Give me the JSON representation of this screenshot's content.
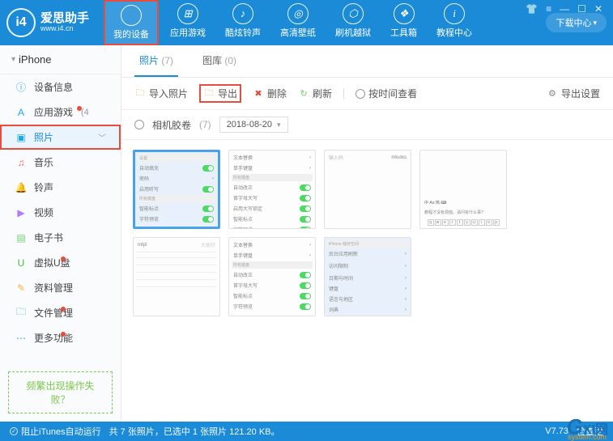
{
  "logo": {
    "title": "爱思助手",
    "url": "www.i4.cn"
  },
  "nav": [
    {
      "label": "我的设备",
      "icon": "",
      "active": true,
      "highlighted": true
    },
    {
      "label": "应用游戏",
      "icon": "⊞"
    },
    {
      "label": "酷炫铃声",
      "icon": "♪"
    },
    {
      "label": "高清壁纸",
      "icon": "◎"
    },
    {
      "label": "刷机越狱",
      "icon": "⬡"
    },
    {
      "label": "工具箱",
      "icon": "❖"
    },
    {
      "label": "教程中心",
      "icon": "i"
    }
  ],
  "download_btn": "下载中心",
  "device_name": "iPhone",
  "sidebar": [
    {
      "label": "设备信息",
      "color": "#1fa8e8",
      "glyph": "ⓘ"
    },
    {
      "label": "应用游戏",
      "color": "#1fa8e8",
      "glyph": "A",
      "count": "(4",
      "dot": true
    },
    {
      "label": "照片",
      "color": "#1fa8e8",
      "glyph": "▣",
      "active": true,
      "highlighted": true,
      "chev": true
    },
    {
      "label": "音乐",
      "color": "#f66",
      "glyph": "♫"
    },
    {
      "label": "铃声",
      "color": "#ffb03a",
      "glyph": "🔔"
    },
    {
      "label": "视频",
      "color": "#b07cff",
      "glyph": "▶"
    },
    {
      "label": "电子书",
      "color": "#6fcf6f",
      "glyph": "▤"
    },
    {
      "label": "虚拟U盘",
      "color": "#3bbf3b",
      "glyph": "U",
      "dot": true
    },
    {
      "label": "资料管理",
      "color": "#ffb03a",
      "glyph": "✎"
    },
    {
      "label": "文件管理",
      "color": "#1fa8e8",
      "glyph": "🗀",
      "dot": true
    },
    {
      "label": "更多功能",
      "color": "#1fa8e8",
      "glyph": "⋯",
      "dot": true
    }
  ],
  "help_link": "频繁出现操作失败？",
  "tabs": [
    {
      "label": "照片",
      "count": "(7)",
      "active": true
    },
    {
      "label": "图库",
      "count": "(0)"
    }
  ],
  "toolbar": {
    "import": "导入照片",
    "export": "导出",
    "delete": "删除",
    "refresh": "刷新",
    "by_time": "按时间查看",
    "export_settings": "导出设置"
  },
  "filter": {
    "camera_roll": "相机胶卷",
    "count": "(7)",
    "date": "2018-08-20"
  },
  "thumbs_kbd": [
    "q",
    "w",
    "e",
    "r",
    "t",
    "y",
    "u",
    "i",
    "o",
    "p"
  ],
  "thumb_hint": "教程才没有烦恼。请问有什么事?",
  "statusbar": {
    "itunes": "阻止iTunes自动运行",
    "info": "共 7 张照片，已选中 1 张照片 121.20 KB。",
    "version": "V7.73",
    "check_update": "检查更"
  },
  "watermark": {
    "g": "G",
    "rest": "XI网",
    "sub": "system.com"
  }
}
